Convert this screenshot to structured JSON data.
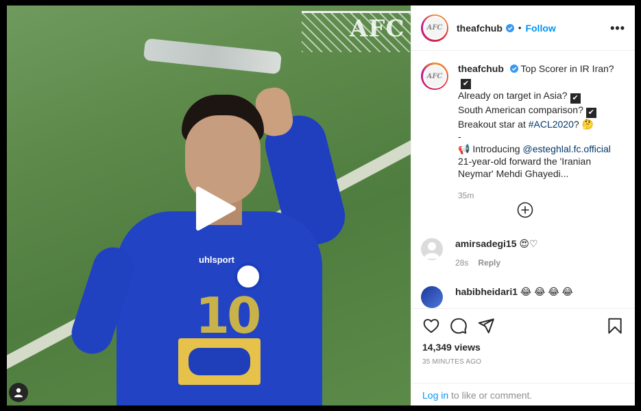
{
  "post": {
    "username": "theafchub",
    "follow_label": "Follow",
    "more_label": "•••",
    "dot": "•",
    "logo_text": "AFC",
    "watermark": "AFC"
  },
  "caption": {
    "username": "theafchub",
    "line1": "Top Scorer in IR Iran?",
    "line2": "Already on target in Asia?",
    "line3": "South American comparison?",
    "line4_prefix": "Breakout star at ",
    "hashtag": "#ACL2020",
    "line4_suffix": "? 🤔",
    "dash": "-",
    "intro_prefix": "📢 Introducing ",
    "mention": "@esteghlal.fc.official",
    "line6": "21-year-old forward the 'Iranian Neymar' Mehdi Ghayedi...",
    "time": "35m",
    "check": "✔"
  },
  "comments": [
    {
      "username": "amirsadegi15",
      "text": "😍♡",
      "time": "28s",
      "reply": "Reply"
    },
    {
      "username": "habibheidari1",
      "text": "😂 😂 😂 😂"
    }
  ],
  "media": {
    "jersey_number": "10",
    "jersey_brand": "uhlsport"
  },
  "footer": {
    "views": "14,349 views",
    "posted": "35 MINUTES AGO",
    "login_link": "Log in",
    "login_suffix": " to like or comment."
  },
  "colors": {
    "accent": "#0095f6",
    "text": "#262626",
    "muted": "#8e8e8e"
  }
}
